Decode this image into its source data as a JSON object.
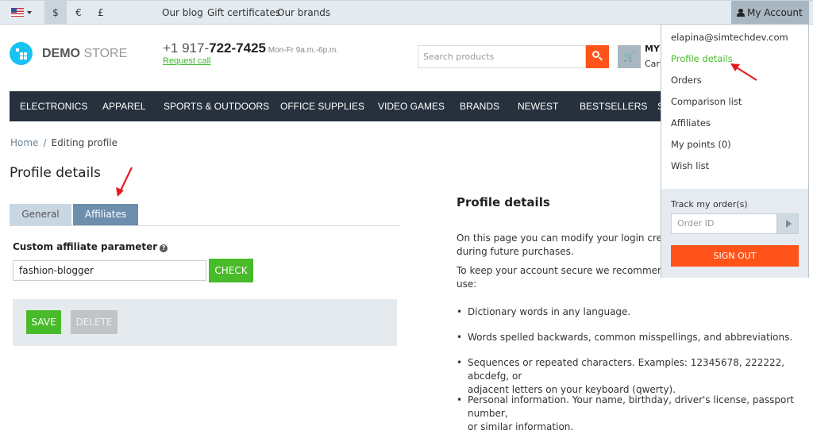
{
  "topbar": {
    "language_icon": "us-flag-icon",
    "currencies": [
      "$",
      "€",
      "£"
    ],
    "active_currency": "$",
    "links": [
      "Our blog",
      "Gift certificates",
      "Our brands"
    ],
    "account_label": "My Account"
  },
  "header": {
    "logo_bold": "DEMO",
    "logo_light": " STORE",
    "phone_prefix": "+1 917-",
    "phone_main": "722-7425",
    "phone_hours": " Mon-Fr 9a.m.-6p.m.",
    "request_call": "Request call",
    "search_placeholder": "Search products",
    "cart_title": "MY",
    "cart_sub": "Cart"
  },
  "nav": {
    "items": [
      "ELECTRONICS",
      "APPAREL",
      "SPORTS & OUTDOORS",
      "OFFICE SUPPLIES",
      "VIDEO GAMES",
      "BRANDS",
      "NEWEST",
      "BESTSELLERS",
      "S"
    ]
  },
  "breadcrumb": {
    "home": "Home",
    "separator": "/",
    "current": "Editing profile"
  },
  "page": {
    "title": "Profile details",
    "tabs": [
      {
        "label": "General",
        "active": false
      },
      {
        "label": "Affiliates",
        "active": true
      }
    ],
    "field_label": "Custom affiliate parameter",
    "help_glyph": "?",
    "field_value": "fashion-blogger",
    "check_label": "CHECK",
    "save_label": "SAVE",
    "delete_label": "DELETE"
  },
  "info": {
    "title": "Profile details",
    "p1_line1": "On this page you can modify your login credent",
    "p1_line2": "during future purchases.",
    "p2_line1": "To keep your account secure we recommend to",
    "p2_line2": "use:",
    "bullets": [
      [
        "Dictionary words in any language."
      ],
      [
        "Words spelled backwards, common misspellings, and abbreviations."
      ],
      [
        "Sequences or repeated characters. Examples: 12345678, 222222, abcdefg, or",
        "adjacent letters on your keyboard (qwerty)."
      ],
      [
        "Personal information. Your name, birthday, driver's license, passport number,",
        "or similar information."
      ]
    ]
  },
  "account_menu": {
    "email": "elapina@simtechdev.com",
    "items": [
      {
        "label": "Profile details",
        "active": true
      },
      {
        "label": "Orders",
        "active": false
      },
      {
        "label": "Comparison list",
        "active": false
      },
      {
        "label": "Affiliates",
        "active": false
      },
      {
        "label": "My points (0)",
        "active": false
      },
      {
        "label": "Wish list",
        "active": false
      }
    ],
    "track_label": "Track my order(s)",
    "order_placeholder": "Order ID",
    "sign_out": "SIGN OUT"
  },
  "annotations": {
    "arrow_color": "#e8191f"
  },
  "colors": {
    "accent_green": "#48bb2a",
    "accent_orange": "#ff5319",
    "nav_bg": "#27313e",
    "logo_blue": "#16c3f3"
  }
}
